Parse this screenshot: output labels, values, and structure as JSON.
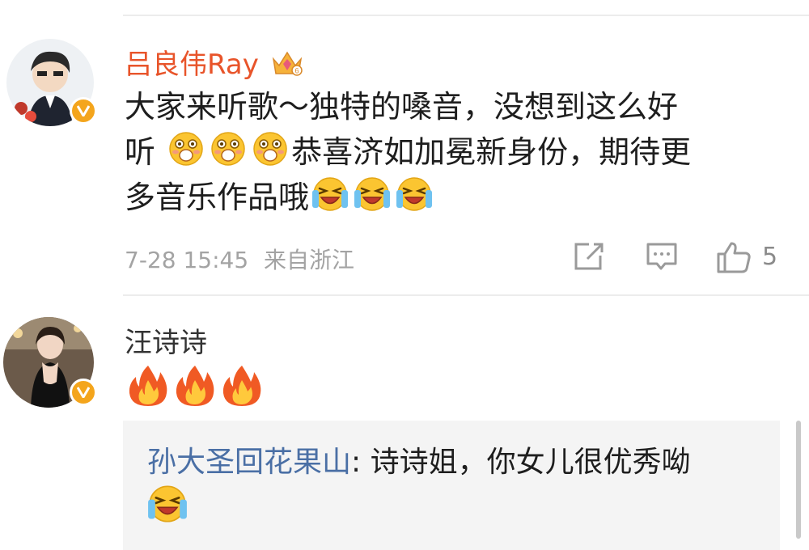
{
  "comments": [
    {
      "username": "吕良伟Ray",
      "text_line1": "大家来听歌～独特的嗓音，没想到这么好",
      "text_line2_pre": "听",
      "text_line2_post": "恭喜济如加冕新身份，期待更",
      "text_line3": "多音乐作品哦",
      "timestamp": "7-28 15:45",
      "source": "来自浙江",
      "like_count": "5"
    },
    {
      "username": "汪诗诗",
      "reply": {
        "author": "孙大圣回花果山",
        "separator": ": ",
        "text": "诗诗姐，你女儿很优秀呦"
      }
    }
  ],
  "icons": {
    "crown": "vip-crown-icon",
    "verified": "verified-v-icon",
    "repost": "repost-icon",
    "comment": "comment-icon",
    "like": "like-thumb-icon",
    "emoji_surprised": "surprised-emoji",
    "emoji_crying_laugh": "crying-laugh-emoji",
    "emoji_fire": "fire-emoji"
  },
  "colors": {
    "vip_name": "#e8542a",
    "reply_author": "#4a6fa5",
    "meta": "#a3a3a3",
    "badge": "#f4a51c"
  }
}
